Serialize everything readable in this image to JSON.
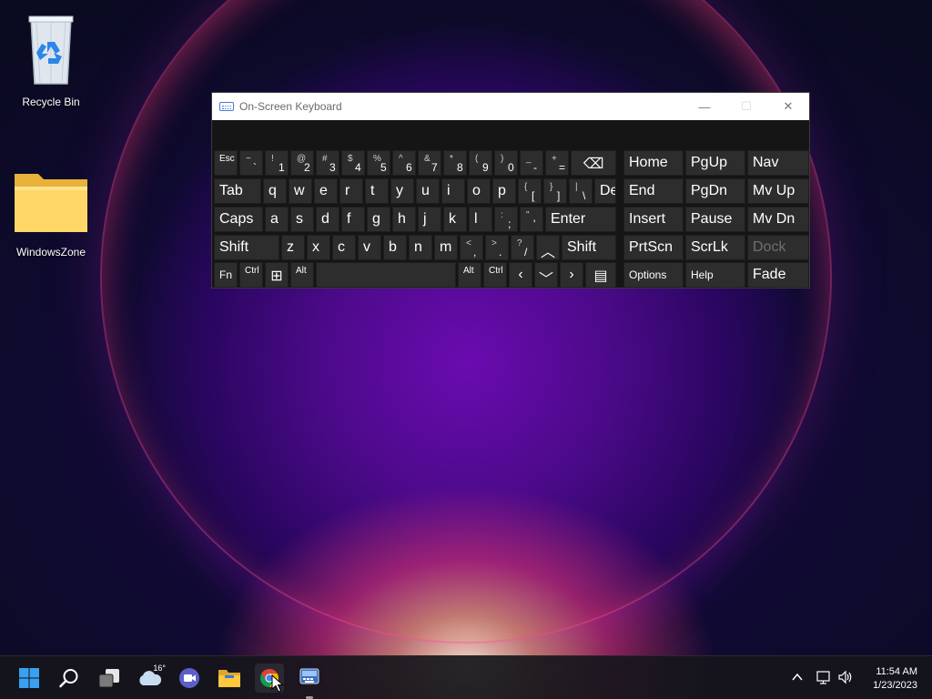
{
  "desktop": {
    "icons": [
      {
        "label": "Recycle Bin",
        "icon": "recycle-bin-icon"
      },
      {
        "label": "WindowsZone",
        "icon": "folder-icon"
      }
    ]
  },
  "osk": {
    "title": "On-Screen Keyboard",
    "icon": "keyboard-icon",
    "controls": {
      "minimize": "—",
      "maximize": "☐",
      "close": "✕"
    },
    "rows": [
      [
        {
          "id": "esc",
          "main": "Esc",
          "style": "small"
        },
        {
          "id": "tilde",
          "shift": "~",
          "base": "`"
        },
        {
          "id": "1",
          "shift": "!",
          "base": "1"
        },
        {
          "id": "2",
          "shift": "@",
          "base": "2"
        },
        {
          "id": "3",
          "shift": "#",
          "base": "3"
        },
        {
          "id": "4",
          "shift": "$",
          "base": "4"
        },
        {
          "id": "5",
          "shift": "%",
          "base": "5"
        },
        {
          "id": "6",
          "shift": "^",
          "base": "6"
        },
        {
          "id": "7",
          "shift": "&",
          "base": "7"
        },
        {
          "id": "8",
          "shift": "*",
          "base": "8"
        },
        {
          "id": "9",
          "shift": "(",
          "base": "9"
        },
        {
          "id": "0",
          "shift": ")",
          "base": "0"
        },
        {
          "id": "minus",
          "shift": "_",
          "base": "-"
        },
        {
          "id": "equals",
          "shift": "+",
          "base": "="
        },
        {
          "id": "backspace",
          "main": "⌫",
          "style": "center"
        }
      ],
      [
        {
          "id": "tab",
          "main": "Tab"
        },
        {
          "id": "q",
          "main": "q"
        },
        {
          "id": "w",
          "main": "w"
        },
        {
          "id": "e",
          "main": "e"
        },
        {
          "id": "r",
          "main": "r"
        },
        {
          "id": "t",
          "main": "t"
        },
        {
          "id": "y",
          "main": "y"
        },
        {
          "id": "u",
          "main": "u"
        },
        {
          "id": "i",
          "main": "i"
        },
        {
          "id": "o",
          "main": "o"
        },
        {
          "id": "p",
          "main": "p"
        },
        {
          "id": "lbracket",
          "shift": "{",
          "base": "["
        },
        {
          "id": "rbracket",
          "shift": "}",
          "base": "]"
        },
        {
          "id": "backslash",
          "shift": "|",
          "base": "\\"
        },
        {
          "id": "del",
          "main": "Del"
        }
      ],
      [
        {
          "id": "caps",
          "main": "Caps"
        },
        {
          "id": "a",
          "main": "a"
        },
        {
          "id": "s",
          "main": "s"
        },
        {
          "id": "d",
          "main": "d"
        },
        {
          "id": "f",
          "main": "f"
        },
        {
          "id": "g",
          "main": "g"
        },
        {
          "id": "h",
          "main": "h"
        },
        {
          "id": "j",
          "main": "j"
        },
        {
          "id": "k",
          "main": "k"
        },
        {
          "id": "l",
          "main": "l"
        },
        {
          "id": "semicolon",
          "shift": ":",
          "base": ";"
        },
        {
          "id": "quote",
          "shift": "\"",
          "base": "'"
        },
        {
          "id": "enter",
          "main": "Enter"
        }
      ],
      [
        {
          "id": "lshift",
          "main": "Shift"
        },
        {
          "id": "z",
          "main": "z"
        },
        {
          "id": "x",
          "main": "x"
        },
        {
          "id": "c",
          "main": "c"
        },
        {
          "id": "v",
          "main": "v"
        },
        {
          "id": "b",
          "main": "b"
        },
        {
          "id": "n",
          "main": "n"
        },
        {
          "id": "m",
          "main": "m"
        },
        {
          "id": "comma",
          "shift": "<",
          "base": ","
        },
        {
          "id": "period",
          "shift": ">",
          "base": "."
        },
        {
          "id": "slash",
          "shift": "?",
          "base": "/"
        },
        {
          "id": "up",
          "main": "︿",
          "style": "center"
        },
        {
          "id": "rshift",
          "main": "Shift"
        }
      ],
      [
        {
          "id": "fn",
          "main": "Fn",
          "style": "mid"
        },
        {
          "id": "lctrl",
          "main": "Ctrl",
          "style": "small"
        },
        {
          "id": "win",
          "main": "⊞",
          "style": "center"
        },
        {
          "id": "lalt",
          "main": "Alt",
          "style": "small"
        },
        {
          "id": "space",
          "main": ""
        },
        {
          "id": "ralt",
          "main": "Alt",
          "style": "small"
        },
        {
          "id": "rctrl",
          "main": "Ctrl",
          "style": "small"
        },
        {
          "id": "left",
          "main": "‹",
          "style": "center"
        },
        {
          "id": "down",
          "main": "﹀",
          "style": "center"
        },
        {
          "id": "right",
          "main": "›",
          "style": "center"
        },
        {
          "id": "menu",
          "main": "▤",
          "style": "center"
        }
      ]
    ],
    "nav": [
      [
        {
          "id": "home",
          "main": "Home"
        },
        {
          "id": "pgup",
          "main": "PgUp"
        },
        {
          "id": "nav",
          "main": "Nav"
        }
      ],
      [
        {
          "id": "end",
          "main": "End"
        },
        {
          "id": "pgdn",
          "main": "PgDn"
        },
        {
          "id": "mvup",
          "main": "Mv Up"
        }
      ],
      [
        {
          "id": "insert",
          "main": "Insert"
        },
        {
          "id": "pause",
          "main": "Pause"
        },
        {
          "id": "mvdn",
          "main": "Mv Dn"
        }
      ],
      [
        {
          "id": "prtscn",
          "main": "PrtScn"
        },
        {
          "id": "scrlk",
          "main": "ScrLk"
        },
        {
          "id": "dock",
          "main": "Dock",
          "style": "dim"
        }
      ],
      [
        {
          "id": "options",
          "main": "Options",
          "style": "mid"
        },
        {
          "id": "help",
          "main": "Help",
          "style": "mid"
        },
        {
          "id": "fade",
          "main": "Fade"
        }
      ]
    ]
  },
  "taskbar": {
    "icons": [
      "start-icon",
      "search-icon",
      "task-view-icon",
      "weather-icon",
      "chat-icon",
      "file-explorer-icon",
      "chrome-icon",
      "osk-app-icon"
    ],
    "weather_temp": "16°",
    "tray_icons": [
      "chevron-up-icon",
      "network-icon",
      "volume-icon"
    ],
    "time": "11:54 AM",
    "date": "1/23/2023"
  }
}
